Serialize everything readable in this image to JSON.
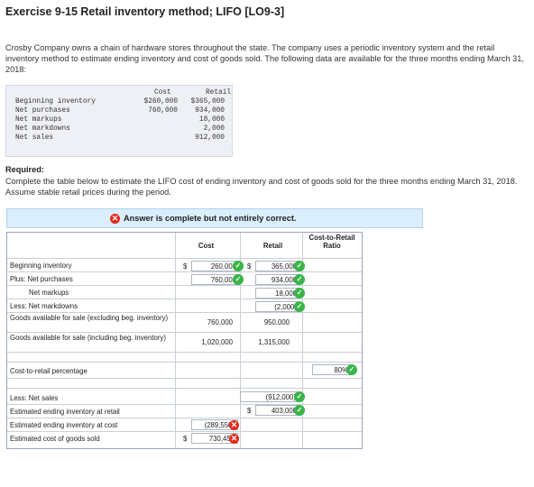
{
  "title": "Exercise 9-15 Retail inventory method; LIFO [LO9-3]",
  "intro": "Crosby Company owns a chain of hardware stores throughout the state. The company uses a periodic inventory system and the retail inventory method to estimate ending inventory and cost of goods sold. The following data are available for the three months ending March 31, 2018:",
  "given": {
    "col_cost": "Cost",
    "col_retail": "Retail",
    "rows": [
      {
        "label": "Beginning inventory",
        "cost": "$260,000",
        "retail": "$365,000"
      },
      {
        "label": "Net purchases",
        "cost": "760,000",
        "retail": "934,000"
      },
      {
        "label": "Net markups",
        "cost": "",
        "retail": "18,000"
      },
      {
        "label": "Net markdowns",
        "cost": "",
        "retail": "2,000"
      },
      {
        "label": "Net sales",
        "cost": "",
        "retail": "912,000"
      }
    ]
  },
  "required": {
    "heading": "Required:",
    "text": "Complete the table below to estimate the LIFO cost of ending inventory and cost of goods sold for the three months ending March 31, 2018. Assume stable retail prices during the period."
  },
  "banner": {
    "text": "Answer is complete but not entirely correct.",
    "icon": "x-circle-icon",
    "color": "#e5281a"
  },
  "table": {
    "col_cost": "Cost",
    "col_retail": "Retail",
    "col_ratio": "Cost-to-Retail Ratio",
    "rows": {
      "beg_inv": "Beginning inventory",
      "net_purch": "Plus: Net purchases",
      "net_markups": "Net markups",
      "net_markdowns": "Less: Net markdowns",
      "avail_excl": "Goods available for sale (excluding beg. inventory)",
      "avail_incl": "Goods available for sale (including beg. inventory)",
      "ratio_pct": "Cost-to-retail percentage",
      "net_sales": "Less: Net sales",
      "end_retail": "Estimated ending inventory at retail",
      "end_cost": "Estimated ending inventory at cost",
      "cogs": "Estimated cost of goods sold"
    },
    "values": {
      "dollar": "$",
      "beg_cost": "260,000",
      "beg_retail": "365,000",
      "purch_cost": "760,000",
      "purch_retail": "934,000",
      "markups_retail": "18,000",
      "markdowns_retail": "(2,000)",
      "excl_cost": "760,000",
      "excl_retail": "950,000",
      "incl_cost": "1,020,000",
      "incl_retail": "1,315,000",
      "ratio": "80%",
      "sales_retail": "(912,000)",
      "end_retail": "403,000",
      "end_cost": "(289,550)",
      "cogs": "730,450"
    },
    "status_colors": {
      "correct": "#39b54a",
      "incorrect": "#e5281a"
    }
  }
}
